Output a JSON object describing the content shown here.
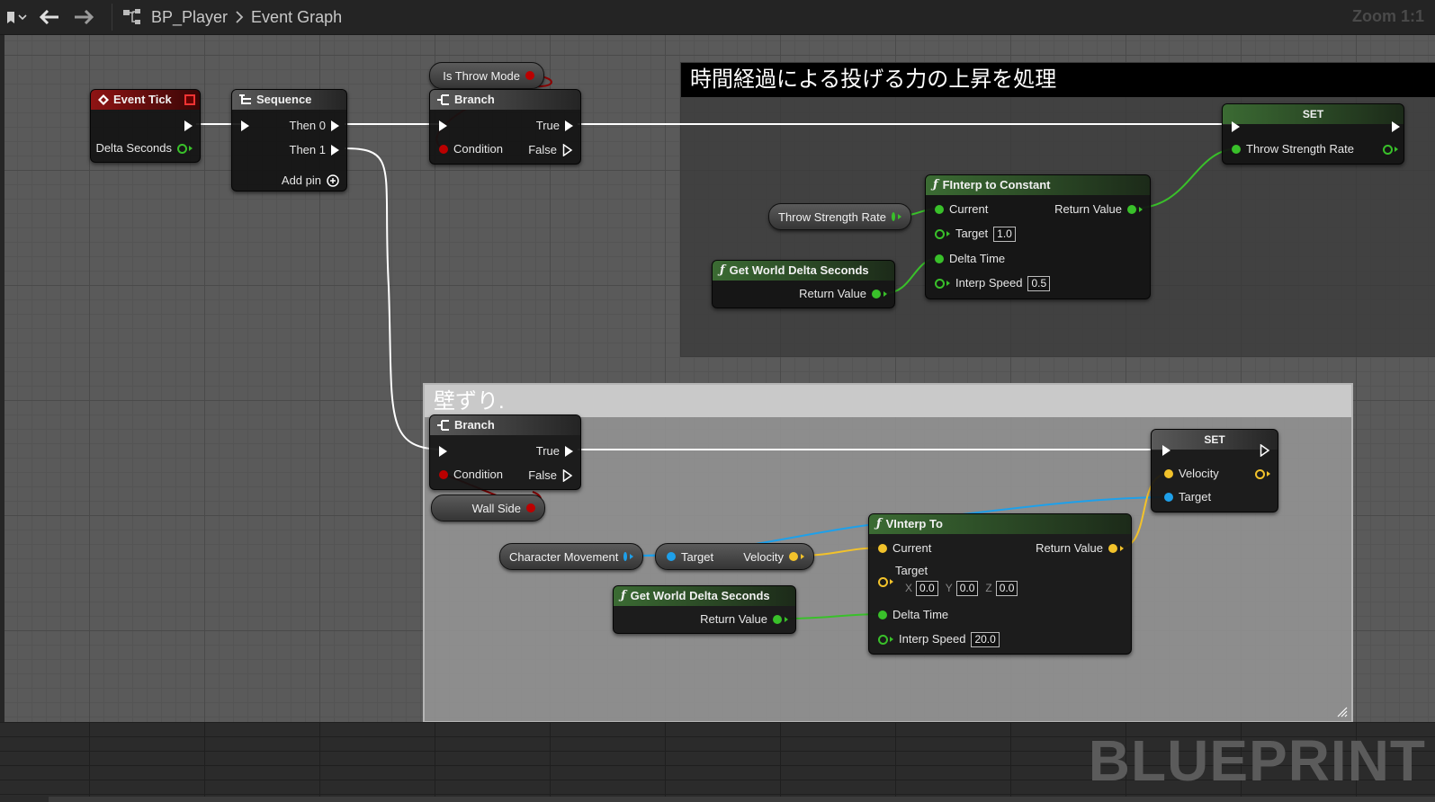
{
  "toolbar": {
    "breadcrumb": [
      "BP_Player",
      "Event Graph"
    ],
    "zoom": "Zoom 1:1"
  },
  "watermark": "BLUEPRINT",
  "comments": [
    {
      "title": "時間経過による投げる力の上昇を処理"
    },
    {
      "title": "壁ずり."
    }
  ],
  "colors": {
    "exec": "#ffffff",
    "bool": "#8b0000",
    "float": "#39c02a",
    "vector": "#f2c22b",
    "object": "#1ea0ea"
  },
  "nodes": {
    "event_tick": {
      "title": "Event Tick",
      "out_delta": "Delta Seconds"
    },
    "sequence": {
      "title": "Sequence",
      "then0": "Then 0",
      "then1": "Then 1",
      "add_pin": "Add pin"
    },
    "branch_top": {
      "title": "Branch",
      "true": "True",
      "false": "False",
      "condition": "Condition"
    },
    "is_throw_mode": {
      "label": "Is Throw Mode"
    },
    "set_top": {
      "title": "SET",
      "pin": "Throw Strength Rate"
    },
    "throw_strength_get": {
      "label": "Throw Strength Rate"
    },
    "finterp": {
      "title": "FInterp to Constant",
      "current": "Current",
      "target": "Target",
      "target_val": "1.0",
      "delta": "Delta Time",
      "speed": "Interp Speed",
      "speed_val": "0.5",
      "ret": "Return Value"
    },
    "gwds_top": {
      "title": "Get World Delta Seconds",
      "ret": "Return Value"
    },
    "branch_bottom": {
      "title": "Branch",
      "true": "True",
      "false": "False",
      "condition": "Condition"
    },
    "wall_side": {
      "label": "Wall Side"
    },
    "set_bottom": {
      "title": "SET",
      "velocity": "Velocity",
      "target": "Target"
    },
    "char_movement": {
      "label": "Character Movement"
    },
    "velocity_get": {
      "target": "Target",
      "velocity": "Velocity"
    },
    "gwds_bottom": {
      "title": "Get World Delta Seconds",
      "ret": "Return Value"
    },
    "vinterp": {
      "title": "VInterp To",
      "current": "Current",
      "ret": "Return Value",
      "target": "Target",
      "x_label": "X",
      "x": "0.0",
      "y_label": "Y",
      "y": "0.0",
      "z_label": "Z",
      "z": "0.0",
      "delta": "Delta Time",
      "speed": "Interp Speed",
      "speed_val": "20.0"
    }
  }
}
